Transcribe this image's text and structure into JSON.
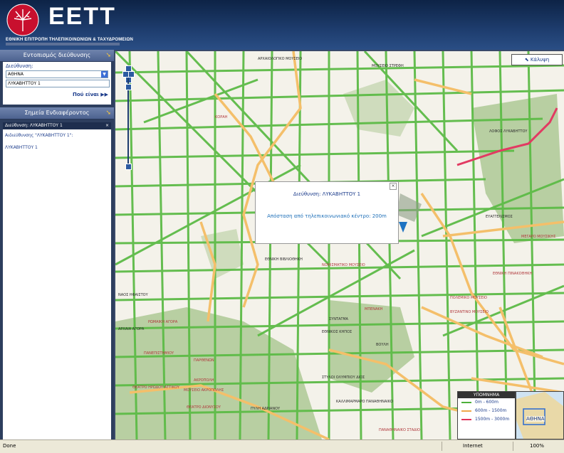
{
  "header": {
    "logo_text": "EETT",
    "subtitle": "ΕΘΝΙΚΗ ΕΠΙΤΡΟΠΗ ΤΗΛΕΠΙΚΟΙΝΩΝΙΩΝ & ΤΑΧΥΔΡΟΜΕΙΩΝ"
  },
  "sidebar": {
    "locate_title": "Εντοπισμός διεύθυνσης",
    "address_label": "Διεύθυνση:",
    "city_value": "ΑΘΗΝΑ",
    "street_value": "ΛΥΚΑΒΗΤΤΟΥ 1",
    "where_button": "Πού είναι",
    "poi_title": "Σημεία Ενδιαφέροντος",
    "result_header": "Διεύθυνση: ΛΥΚΑΒΗΤΤΟΥ 1",
    "result_heading": "Αιδιεύθυνσης \"ΛΥΚΑΒΗΤΤΟΥ 1\":",
    "result_item": "ΛΥΚΑΒΗΤΤΟΥ 1"
  },
  "map": {
    "cover_button": "Κάλυψη",
    "popup_address": "Διεύθυνση: ΛΥΚΑΒΗΤΤΟΥ 1",
    "popup_distance": "Απόσταση από τηλεπικοινωνιακό κέντρο: 200m",
    "labels": [
      "ΑΡΧΑΙΟΛΟΓΙΚΟ ΜΟΥΣΕΙΟ",
      "ΜΟΥΣΕΙΟ ΣΤΡΕΦΗ",
      "ΛΟΦΟΣ ΛΥΚΑΒΗΤΤΟΥ",
      "ΝΑΟΣ ΗΦΑΙΣΤΟΥ",
      "ΑΡΧΑΙΑ ΑΓΟΡΑ",
      "ΡΩΜΑΙΚΗ ΑΓΟΡΑ",
      "ΠΑΝΕΠΙΣΤΗΜΙΟΥ",
      "ΑΚΡΟΠΟΛΗ",
      "ΘΕΑΤΡΟ ΗΡΩΔΟΥ ΑΤΤΙΚΟΥ",
      "ΠΑΡΘΕΝΩΝ",
      "ΘΕΑΤΡΟ ΔΙΟΝΥΣΟΥ",
      "ΜΟΥΣΕΙΟ ΑΚΡΟΠΟΛΗΣ",
      "ΣΥΝΤΑΓΜΑ",
      "ΕΘΝΙΚΟΣ ΚΗΠΟΣ",
      "ΒΟΥΛΗ",
      "ΣΤΥΛΟΙ ΟΛΥΜΠΙΟΥ ΔΙΟΣ",
      "ΠΥΛΗ ΑΔΡΙΑΝΟΥ",
      "ΚΑΛΛΙΜΑΡΜΑΡΟ ΠΑΝΑΘΗΝΑΙΚΟ",
      "ΠΑΝΑΘΗΝΑΙΚΟ ΣΤΑΔΙΟ",
      "ΕΥΑΓΓΕΛΙΣΜΟΣ",
      "ΜΕΓΑΡΟ ΜΟΥΣΙΚΗΣ",
      "ΜΠΕΝΑΚΗ",
      "ΒΥΖΑΝΤΙΝΟ ΜΟΥΣΕΙΟ",
      "ΠΟΛΕΜΙΚΟ ΜΟΥΣΕΙΟ",
      "ΕΘΝΙΚΗ ΠΙΝΑΚΟΘΗΚΗ",
      "ΝΟΜΙΣΜΑΤΙΚΟ ΜΟΥΣΕΙΟ",
      "ΚΟΡΑΗ",
      "ΕΘΝΙΚΗ ΒΙΒΛΙΟΘΗΚΗ"
    ],
    "legend": {
      "title": "ΥΠΟΜΝΗΜΑ",
      "rows": [
        {
          "label": "0m - 600m",
          "color": "#4caf3a"
        },
        {
          "label": "600m - 1500m",
          "color": "#f0a84a"
        },
        {
          "label": "1500m - 3000m",
          "color": "#e0355a"
        }
      ]
    },
    "minimap_label": "ΑΘΗΝΑ"
  },
  "statusbar": {
    "status": "Done",
    "zone": "Internet",
    "zoom": "100%"
  }
}
